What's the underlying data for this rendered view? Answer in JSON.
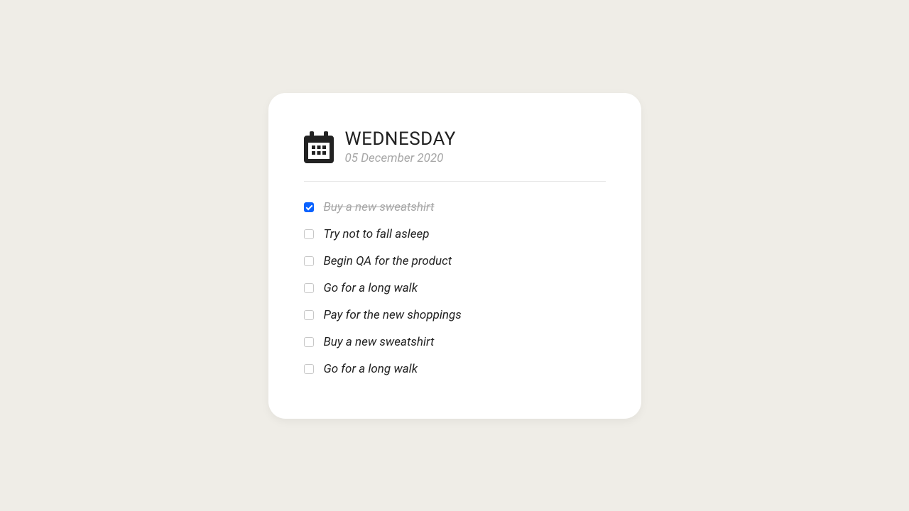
{
  "header": {
    "day_name": "WEDNESDAY",
    "date": "05 December 2020"
  },
  "todos": [
    {
      "label": "Buy a new sweatshirt",
      "done": true
    },
    {
      "label": "Try not to fall asleep",
      "done": false
    },
    {
      "label": "Begin QA for the product",
      "done": false
    },
    {
      "label": "Go for a long walk",
      "done": false
    },
    {
      "label": "Pay for the new shoppings",
      "done": false
    },
    {
      "label": "Buy a new sweatshirt",
      "done": false
    },
    {
      "label": "Go for a long walk",
      "done": false
    }
  ]
}
